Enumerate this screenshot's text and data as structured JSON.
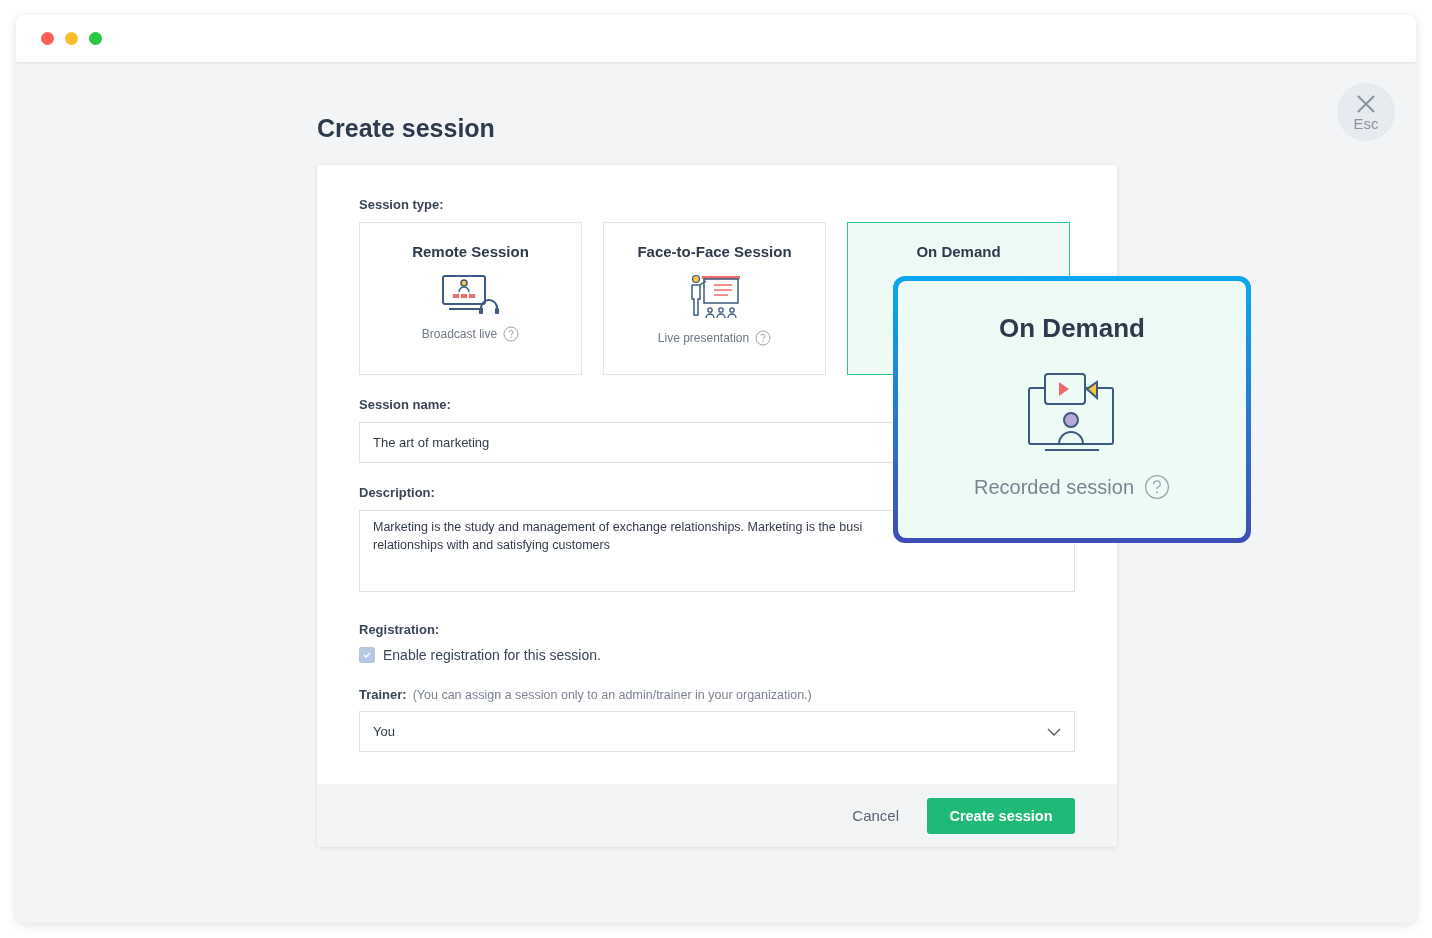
{
  "page": {
    "title": "Create session",
    "close_label": "Esc"
  },
  "session_type": {
    "label": "Session type:",
    "options": [
      {
        "kind": "remote",
        "title": "Remote Session",
        "subtitle": "Broadcast live",
        "selected": false
      },
      {
        "kind": "face",
        "title": "Face-to-Face Session",
        "subtitle": "Live presentation",
        "selected": false
      },
      {
        "title": "On Demand",
        "selected": true
      }
    ]
  },
  "callout": {
    "kind": "demand",
    "title": "On Demand",
    "subtitle": "Recorded session"
  },
  "session_name": {
    "label": "Session name:",
    "value": "The art of marketing"
  },
  "description": {
    "label": "Description:",
    "lines": [
      "Marketing is the study and management of exchange relationships. Marketing is the busi",
      "relationships with and satisfying customers"
    ]
  },
  "registration": {
    "label": "Registration:",
    "option": "Enable registration for this session.",
    "checked": true
  },
  "trainer": {
    "label": "Trainer:",
    "hint": "(You can assign a session only to an admin/trainer in your organization.)",
    "value": "You"
  },
  "buttons": {
    "cancel": "Cancel",
    "submit": "Create session"
  }
}
